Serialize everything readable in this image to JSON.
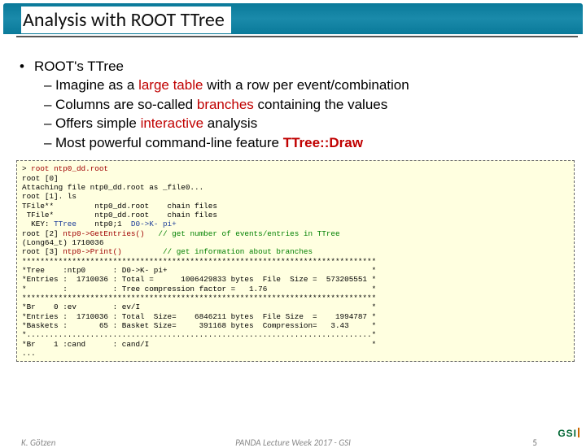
{
  "title": "Analysis with ROOT TTree",
  "main_bullet": "ROOT's TTree",
  "subs": [
    {
      "pre": "Imagine as a ",
      "red": "large table",
      "post": " with a row per event/combination"
    },
    {
      "pre": "Columns are so-called ",
      "red": "branches",
      "post": " containing the values"
    },
    {
      "pre": "Offers simple ",
      "red": "interactive",
      "post": " analysis"
    },
    {
      "pre": "Most powerful command-line feature ",
      "red": "TTree::Draw",
      "post": "",
      "bold_red": true
    }
  ],
  "code": {
    "l01a": "> ",
    "l01b": "root ntp0_dd.root",
    "l02": "root [0]",
    "l03": "Attaching file ntp0_dd.root as _file0...",
    "l04": "root [1]. ls",
    "l05": "TFile**         ntp0_dd.root    chain files",
    "l06": " TFile*         ntp0_dd.root    chain files",
    "l07a": "  KEY: ",
    "l07b": "TTree",
    "l07c": "    ntp0;1  ",
    "l07d": "D0->K- pi+",
    "l08a": "root [2] ",
    "l08b": "ntp0->GetEntries()",
    "l08c": "   // get number of events/entries in TTree",
    "l09": "(Long64_t) 1710036",
    "l10a": "root [3] ",
    "l10b": "ntp0->Print()",
    "l10c": "         // get information about branches",
    "l11": "******************************************************************************",
    "l12": "*Tree    :ntp0      : D0->K- pi+                                             *",
    "l13": "*Entries :  1710036 : Total =      1006429833 bytes  File  Size =  573205551 *",
    "l14": "*        :          : Tree compression factor =   1.76                       *",
    "l15": "******************************************************************************",
    "l16": "*Br    0 :ev        : ev/I                                                   *",
    "l17": "*Entries :  1710036 : Total  Size=    6846211 bytes  File Size  =    1994787 *",
    "l18": "*Baskets :       65 : Basket Size=     391168 bytes  Compression=   3.43     *",
    "l19": "*............................................................................*",
    "l20": "*Br    1 :cand      : cand/I                                                 *",
    "l21": "..."
  },
  "footer": {
    "author": "K. Götzen",
    "venue": "PANDA Lecture Week 2017 - GSI",
    "page": "5",
    "logo": "GSI"
  }
}
